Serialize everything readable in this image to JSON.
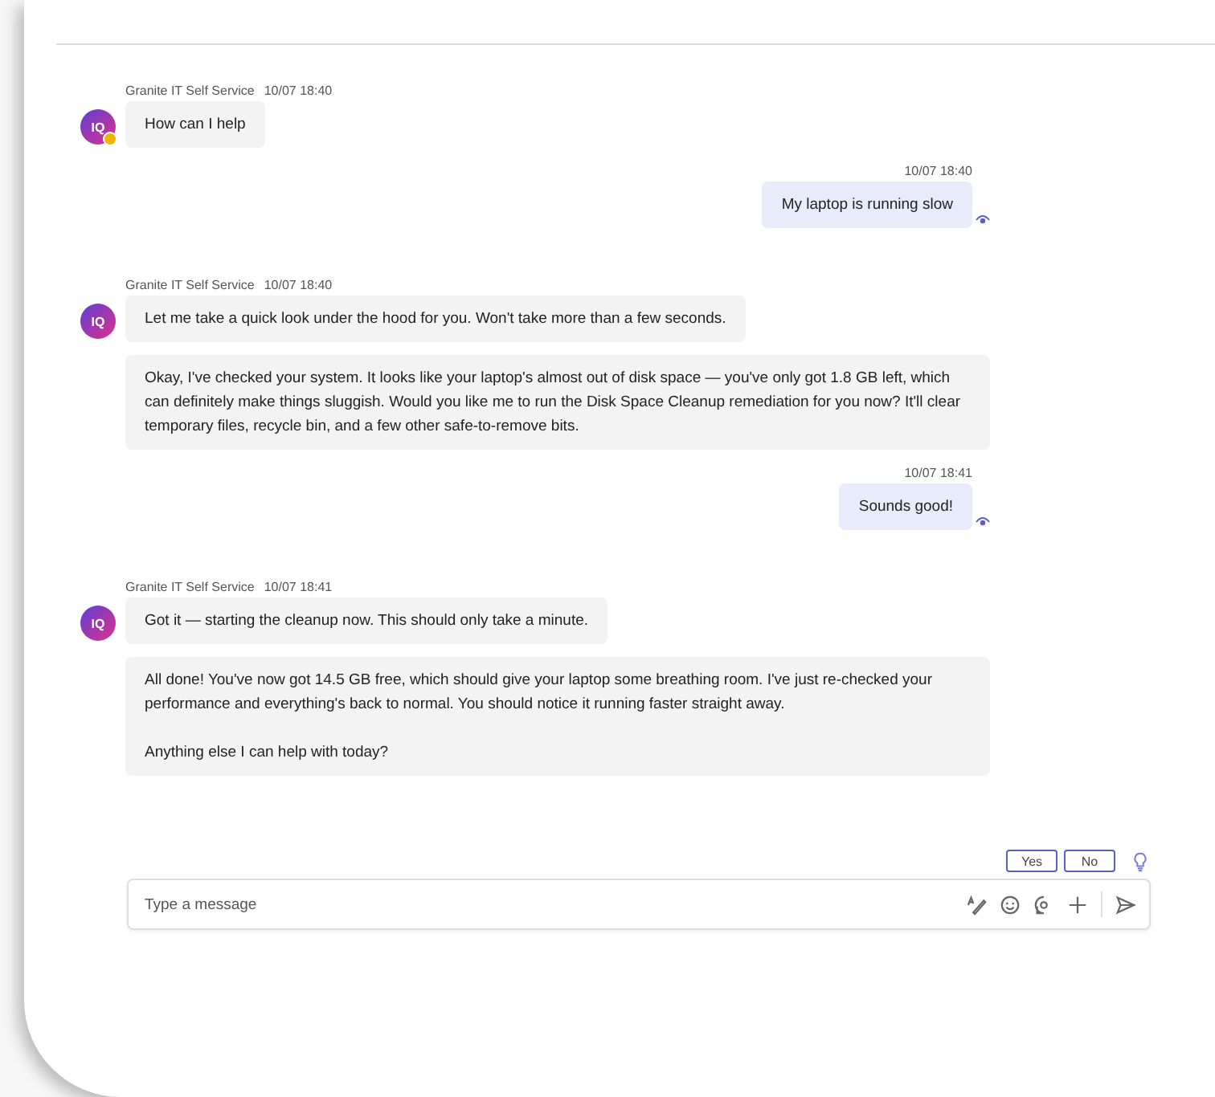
{
  "messages": [
    {
      "kind": "bot",
      "avatar": "IQ",
      "away": true,
      "sender": "Granite IT Self Service",
      "time": "10/07 18:40",
      "bubbles": [
        "How can I help"
      ]
    },
    {
      "kind": "user",
      "time": "10/07 18:40",
      "bubbles": [
        "My laptop is running slow"
      ],
      "seen": true
    },
    {
      "kind": "bot",
      "avatar": "IQ",
      "away": false,
      "sender": "Granite IT Self Service",
      "time": "10/07 18:40",
      "bubbles": [
        "Let me take a quick look under the hood for you. Won't take more than a few seconds.",
        "Okay, I've checked your system. It looks like your laptop's almost out of disk space — you've only got 1.8 GB left, which can definitely make things sluggish. Would you like me to run the Disk Space Cleanup remediation for you now? It'll clear temporary files, recycle bin, and a few other safe-to-remove bits."
      ]
    },
    {
      "kind": "user",
      "time": "10/07 18:41",
      "bubbles": [
        "Sounds good!"
      ],
      "seen": true
    },
    {
      "kind": "bot",
      "avatar": "IQ",
      "away": false,
      "sender": "Granite IT Self Service",
      "time": "10/07 18:41",
      "bubbles": [
        "Got it — starting the cleanup now. This should only take a minute.",
        "All done! You've now got 14.5 GB free, which should give your laptop some breathing room. I've just re-checked your performance and everything's back to normal. You should notice it running faster straight away.\n\nAnything else I can help with today?"
      ]
    }
  ],
  "quick_replies": [
    "Yes",
    "No"
  ],
  "composer": {
    "placeholder": "Type a message"
  }
}
